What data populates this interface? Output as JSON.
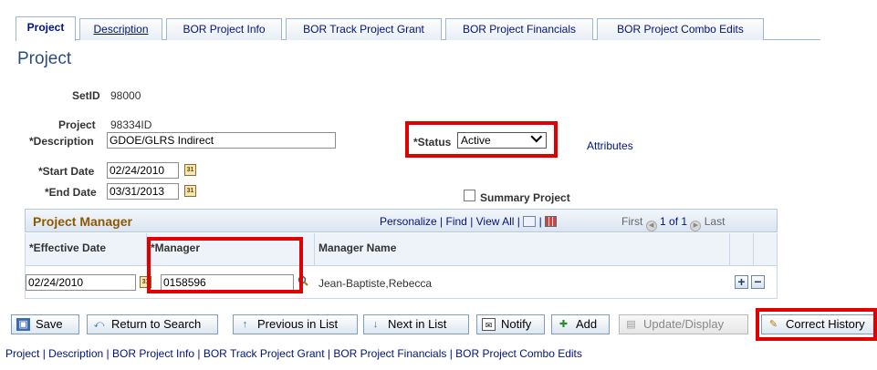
{
  "tabs": [
    {
      "label": "Project",
      "active": true
    },
    {
      "label": "Description",
      "active": false
    },
    {
      "label": "BOR Project Info",
      "active": false
    },
    {
      "label": "BOR Track Project Grant",
      "active": false
    },
    {
      "label": "BOR Project Financials",
      "active": false
    },
    {
      "label": "BOR Project Combo Edits",
      "active": false
    }
  ],
  "page_title": "Project",
  "form": {
    "setid_label": "SetID",
    "setid_value": "98000",
    "project_label": "Project",
    "project_value": "98334ID",
    "description_label": "*Description",
    "description_value": "GDOE/GLRS Indirect",
    "status_label": "*Status",
    "status_value": "Active",
    "attributes_link": "Attributes",
    "start_date_label": "*Start Date",
    "start_date_value": "02/24/2010",
    "end_date_label": "*End Date",
    "end_date_value": "03/31/2013",
    "summary_project_label": "Summary Project",
    "summary_project_checked": false
  },
  "grid": {
    "title": "Project Manager",
    "personalize": "Personalize",
    "find": "Find",
    "view_all": "View All",
    "first": "First",
    "range": "1 of 1",
    "last": "Last",
    "columns": [
      "*Effective Date",
      "*Manager",
      "Manager Name"
    ],
    "rows": [
      {
        "effective_date": "02/24/2010",
        "manager": "0158596",
        "manager_name": "Jean-Baptiste,Rebecca"
      }
    ]
  },
  "toolbar": {
    "save": "Save",
    "return_to_search": "Return to Search",
    "previous_in_list": "Previous in List",
    "next_in_list": "Next in List",
    "notify": "Notify",
    "add": "Add",
    "update_display": "Update/Display",
    "correct_history": "Correct History"
  },
  "footer_links": [
    "Project",
    "Description",
    "BOR Project Info",
    "BOR Track Project Grant",
    "BOR Project Financials",
    "BOR Project Combo Edits"
  ],
  "colors": {
    "highlight_box": "#e00000",
    "link": "#00137c",
    "grid_title": "#8a5a00",
    "page_title": "#2b4e7d"
  }
}
